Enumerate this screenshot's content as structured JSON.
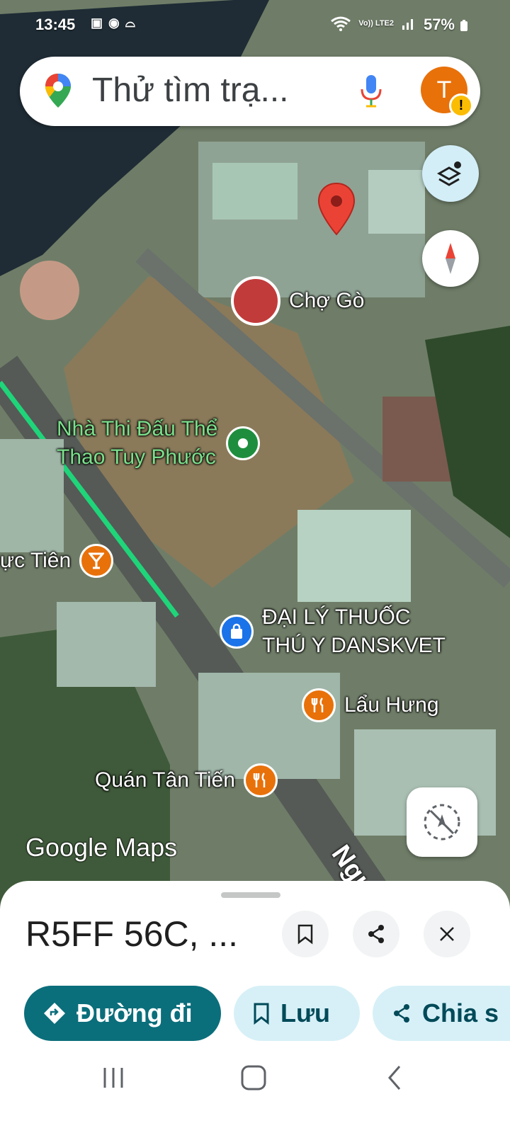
{
  "status_bar": {
    "time": "13:45",
    "network": "Vo)) LTE2",
    "battery": "57%"
  },
  "search": {
    "placeholder": "Thử tìm trạ..."
  },
  "account": {
    "initial": "T",
    "badge": "!"
  },
  "map": {
    "places": {
      "market": "Chợ Gò",
      "stadium_line1": "Nhà Thi Đấu Thể",
      "stadium_line2": "Thao Tuy Phước",
      "bar": "ực Tiên",
      "pharmacy_line1": "ĐẠI LÝ THUỐC",
      "pharmacy_line2": "THÚ Y DANSKVET",
      "hotpot": "Lẩu Hưng",
      "restaurant": "Quán Tân Tiến"
    },
    "road_label": "Ngu",
    "attribution": "Google Maps",
    "colors": {
      "route": "#1fd57a",
      "pin": "#ea4335",
      "stadium_label": "#7be08c"
    }
  },
  "sheet": {
    "title": "R5FF 56C, ...",
    "actions": {
      "directions": "Đường đi",
      "save": "Lưu",
      "share": "Chia s"
    }
  }
}
